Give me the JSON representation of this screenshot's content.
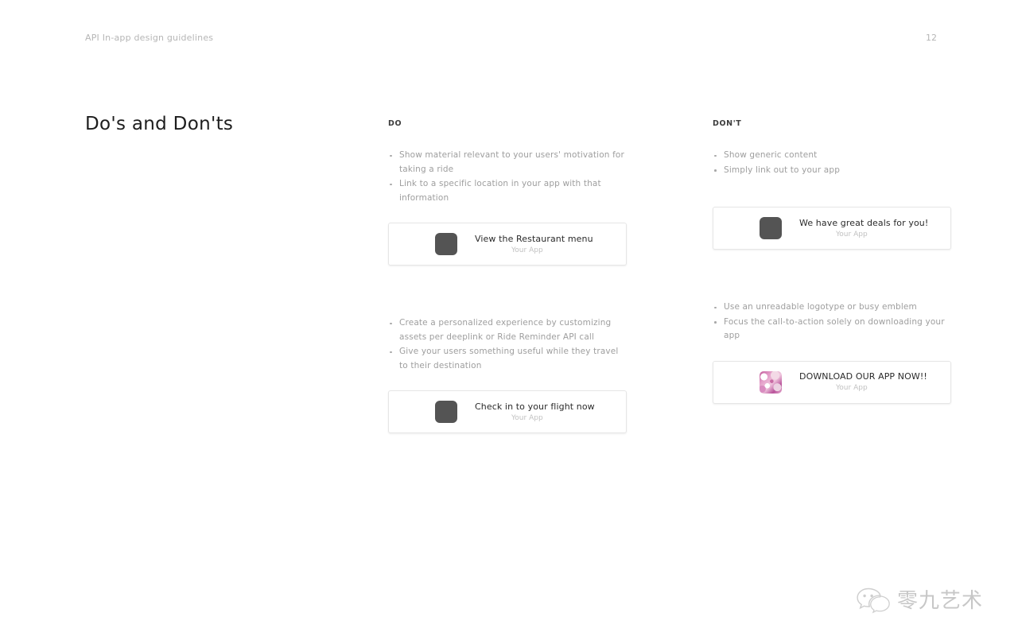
{
  "header": {
    "left_label": "API In-app design guidelines",
    "page_number": "12"
  },
  "title": "Do's and Don'ts",
  "columns": {
    "do": {
      "label": "DO",
      "blocks": [
        {
          "bullets": [
            "Show material relevant to your users' motivation for taking a ride",
            "Link to a specific location in your app with that information"
          ],
          "card": {
            "title": "View the Restaurant menu",
            "subtitle": "Your App",
            "icon": "app-icon-plain"
          }
        },
        {
          "bullets": [
            "Create a personalized experience by customizing assets per deeplink or Ride Reminder API call",
            "Give your users something useful while they travel to their destination"
          ],
          "card": {
            "title": "Check in to your flight now",
            "subtitle": "Your App",
            "icon": "app-icon-plain"
          }
        }
      ]
    },
    "dont": {
      "label": "DON'T",
      "blocks": [
        {
          "bullets": [
            "Show generic content",
            "Simply link out to your app"
          ],
          "card": {
            "title": "We have great deals for you!",
            "subtitle": "Your App",
            "icon": "app-icon-plain"
          }
        },
        {
          "bullets": [
            "Use an unreadable logotype or busy emblem",
            "Focus the call-to-action solely on downloading your app"
          ],
          "card": {
            "title": "DOWNLOAD OUR APP NOW!!",
            "subtitle": "Your App",
            "icon": "app-icon-busy-floral"
          }
        }
      ]
    }
  },
  "watermark": {
    "text": "零九艺术",
    "icon": "wechat-icon"
  },
  "colors": {
    "title": "#1d1d1d",
    "label": "#3d3d3d",
    "body_text": "#9e9e9e",
    "header_text": "#b6b6b6",
    "card_border": "#e6e6e6",
    "card_icon": "#545454",
    "card_subtitle": "#c2c2c2",
    "background": "#ffffff"
  }
}
